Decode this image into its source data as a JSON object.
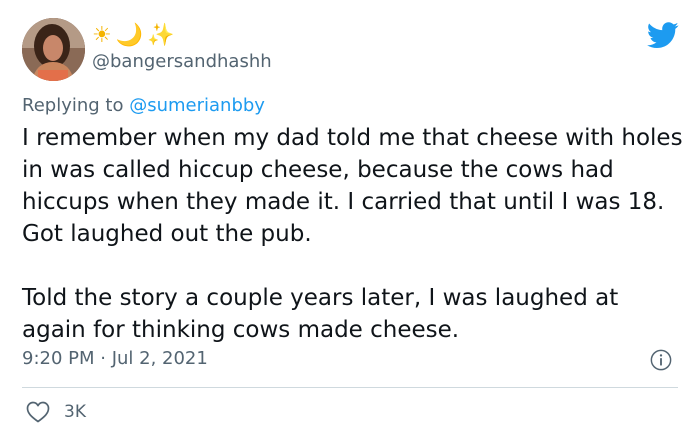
{
  "user": {
    "display_name_emojis": [
      "☀",
      "🌙",
      "✨"
    ],
    "handle": "@bangersandhashh"
  },
  "reply": {
    "prefix": "Replying to",
    "mention": "@sumerianbby"
  },
  "tweet": {
    "paragraphs": [
      "I remember when my dad told me that cheese with holes in was called hiccup cheese, because the cows had hiccups when they made it. I carried that until I was 18. Got laughed out the pub.",
      "Told the story a couple years later, I was laughed at again for thinking cows made cheese."
    ],
    "timestamp": "9:20 PM · Jul 2, 2021"
  },
  "stats": {
    "likes": "3K"
  },
  "icons": {
    "platform": "twitter-bird-icon",
    "info": "info-icon",
    "like": "heart-icon"
  },
  "colors": {
    "brand": "#1d9bf0",
    "secondary_text": "#536471",
    "divider": "#cfd9de"
  }
}
